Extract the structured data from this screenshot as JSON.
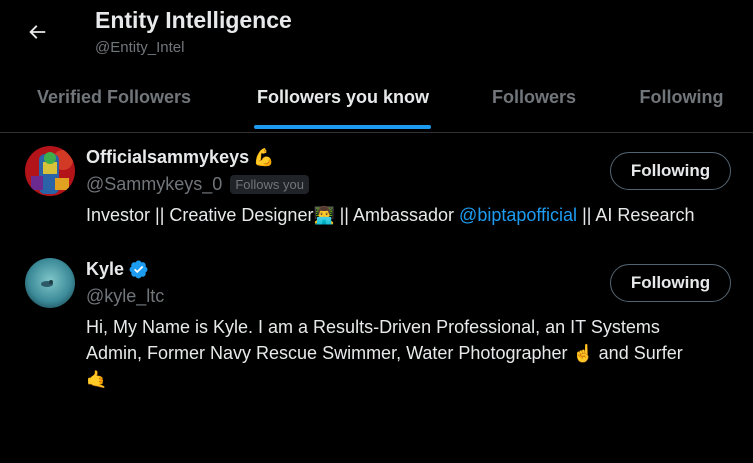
{
  "header": {
    "title": "Entity Intelligence",
    "handle": "@Entity_Intel"
  },
  "tabs": [
    {
      "label": "Verified Followers",
      "active": false
    },
    {
      "label": "Followers you know",
      "active": true
    },
    {
      "label": "Followers",
      "active": false
    },
    {
      "label": "Following",
      "active": false
    }
  ],
  "users": [
    {
      "name": "Officialsammykeys",
      "name_emoji": "💪",
      "handle": "@Sammykeys_0",
      "follows_you": "Follows you",
      "button": "Following",
      "bio_part1": "Investor || Creative Designer",
      "bio_emoji": "👨‍💻",
      "bio_part2": " || Ambassador ",
      "bio_mention": "@biptapofficial",
      "bio_part3": " || AI Research"
    },
    {
      "name": "Kyle",
      "verified": true,
      "handle": "@kyle_ltc",
      "button": "Following",
      "bio_line1": "Hi, My Name is Kyle. I am a Results-Driven Professional, an IT Systems",
      "bio_line2": "Admin, Former Navy Rescue Swimmer, Water Photographer ",
      "bio_emoji1": "☝️",
      "bio_line2b": " and Surfer",
      "bio_emoji2": "🤙"
    }
  ],
  "colors": {
    "background": "#000000",
    "accent": "#1d9bf0",
    "text_primary": "#e7e9ea",
    "text_secondary": "#71767b"
  },
  "icons": {
    "back": "arrow-left-icon",
    "verified": "verified-badge-icon"
  }
}
